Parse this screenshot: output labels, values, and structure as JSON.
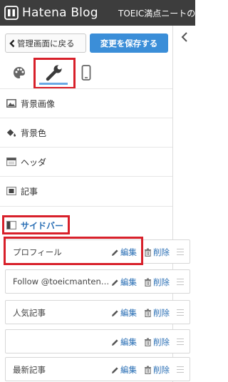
{
  "header": {
    "logo_text": "Hatena Blog",
    "blog_title": "TOEIC満点ニートのブ"
  },
  "toolbar": {
    "back_label": "管理画面に戻る",
    "save_label": "変更を保存する"
  },
  "tabs": [
    {
      "name": "design",
      "icon": "palette-icon"
    },
    {
      "name": "customize",
      "icon": "wrench-icon",
      "active": true
    },
    {
      "name": "smartphone",
      "icon": "smartphone-icon"
    }
  ],
  "sections": [
    {
      "label": "背景画像",
      "icon": "image-icon"
    },
    {
      "label": "背景色",
      "icon": "paint-bucket-icon"
    },
    {
      "label": "ヘッダ",
      "icon": "header-layout-icon"
    },
    {
      "label": "記事",
      "icon": "article-layout-icon"
    },
    {
      "label": "サイドバー",
      "icon": "sidebar-layout-icon",
      "active": true
    }
  ],
  "modules": [
    {
      "name": "プロフィール",
      "edit": "編集",
      "delete": "削除"
    },
    {
      "name": "Follow @toeicmanten…",
      "edit": "編集",
      "delete": "削除"
    },
    {
      "name": "人気記事",
      "edit": "編集",
      "delete": "削除"
    },
    {
      "name": "",
      "edit": "編集",
      "delete": "削除"
    },
    {
      "name": "最新記事",
      "edit": "編集",
      "delete": "削除"
    }
  ],
  "colors": {
    "topbar": "#3d3d3d",
    "primary_button": "#3b8ed8",
    "link": "#2a6fb5",
    "highlight": "#d8202a"
  }
}
